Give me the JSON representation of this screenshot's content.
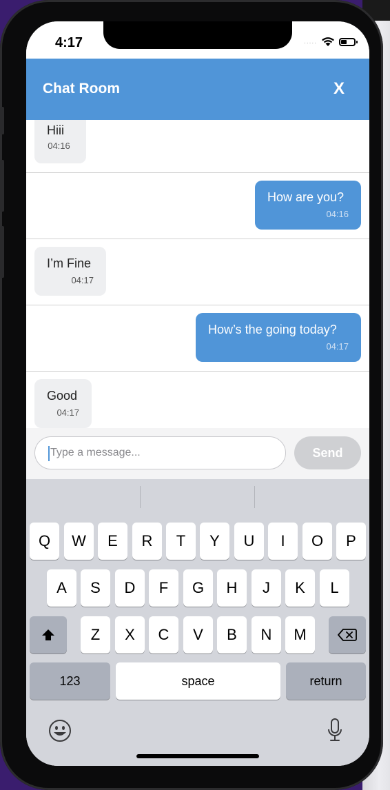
{
  "status_bar": {
    "time": "4:17",
    "signal_dots": "....."
  },
  "header": {
    "title": "Chat Room",
    "close_label": "X"
  },
  "messages": [
    {
      "direction": "incoming",
      "text": "Hiii",
      "time": "04:16"
    },
    {
      "direction": "outgoing",
      "text": "How are you?",
      "time": "04:16"
    },
    {
      "direction": "incoming",
      "text": "I’m Fine",
      "time": "04:17"
    },
    {
      "direction": "outgoing",
      "text": "How’s the going today?",
      "time": "04:17"
    },
    {
      "direction": "incoming",
      "text": "Good",
      "time": "04:17"
    }
  ],
  "composer": {
    "placeholder": "Type a message...",
    "send_label": "Send"
  },
  "keyboard": {
    "row1": [
      "Q",
      "W",
      "E",
      "R",
      "T",
      "Y",
      "U",
      "I",
      "O",
      "P"
    ],
    "row2": [
      "A",
      "S",
      "D",
      "F",
      "G",
      "H",
      "J",
      "K",
      "L"
    ],
    "row3": [
      "Z",
      "X",
      "C",
      "V",
      "B",
      "N",
      "M"
    ],
    "numbers_label": "123",
    "space_label": "space",
    "return_label": "return"
  },
  "colors": {
    "accent": "#5095d8",
    "incoming_bubble": "#eeeff1",
    "send_disabled": "#cfd0d3",
    "keyboard_bg": "#d3d5db"
  },
  "icons": [
    "wifi-icon",
    "battery-icon",
    "close-icon",
    "shift-icon",
    "backspace-icon",
    "emoji-icon",
    "microphone-icon"
  ]
}
